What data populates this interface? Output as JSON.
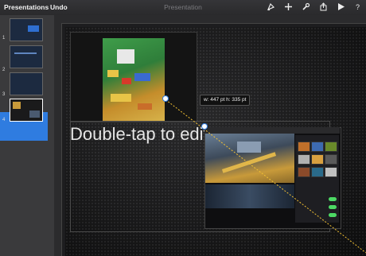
{
  "toolbar": {
    "presentations_label": "Presentations",
    "undo_label": "Undo",
    "title": "Presentation",
    "icons": [
      "format-brush-icon",
      "add-icon",
      "wrench-icon",
      "share-icon",
      "play-icon",
      "help-icon"
    ]
  },
  "navigator": {
    "slides": [
      {
        "number": "1"
      },
      {
        "number": "2"
      },
      {
        "number": "3"
      },
      {
        "number": "4",
        "selected": true
      }
    ]
  },
  "slide": {
    "placeholder_text": "Double-tap to edit",
    "size_badge": "w: 447 pt  h: 335 pt"
  },
  "colors": {
    "accent": "#2f7ce0",
    "toolbar_bg": "#2a2a2c",
    "guide_line": "#f2c033"
  }
}
